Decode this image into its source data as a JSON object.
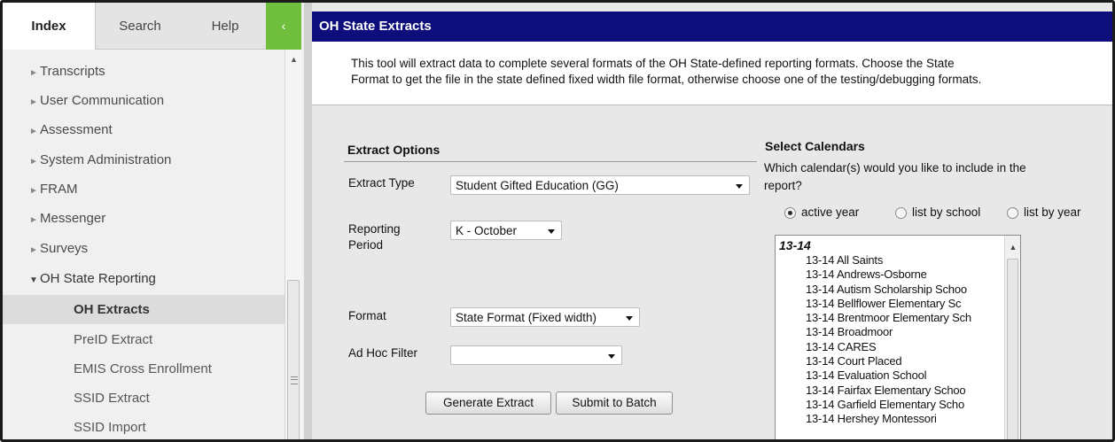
{
  "sidebar": {
    "tabs": [
      {
        "label": "Index"
      },
      {
        "label": "Search"
      },
      {
        "label": "Help"
      }
    ],
    "collapse_glyph": "‹",
    "menu": [
      {
        "label": "Transcripts",
        "arrow": "►"
      },
      {
        "label": "User Communication",
        "arrow": "►"
      },
      {
        "label": "Assessment",
        "arrow": "►"
      },
      {
        "label": "System Administration",
        "arrow": "►"
      },
      {
        "label": "FRAM",
        "arrow": "►"
      },
      {
        "label": "Messenger",
        "arrow": "►"
      },
      {
        "label": "Surveys",
        "arrow": "►"
      },
      {
        "label": "OH State Reporting",
        "arrow": "▼"
      }
    ],
    "submenu": [
      {
        "label": "OH Extracts"
      },
      {
        "label": "PreID Extract"
      },
      {
        "label": "EMIS Cross Enrollment"
      },
      {
        "label": "SSID Extract"
      },
      {
        "label": "SSID Import"
      }
    ]
  },
  "main": {
    "title": "OH State Extracts",
    "description_line1": "This tool will extract data to complete several formats of the OH State-defined reporting formats. Choose the State",
    "description_line2": "Format to get the file in the state defined fixed width file format, otherwise choose one of the testing/debugging formats.",
    "extract_options": {
      "heading": "Extract Options",
      "extract_type_label": "Extract Type",
      "extract_type_value": "Student Gifted Education (GG)",
      "reporting_period_label_1": "Reporting",
      "reporting_period_label_2": "Period",
      "reporting_period_value": "K - October",
      "format_label": "Format",
      "format_value": "State Format (Fixed width)",
      "ad_hoc_label": "Ad Hoc Filter",
      "ad_hoc_value": "",
      "generate_button": "Generate Extract",
      "batch_button": "Submit to Batch"
    },
    "calendars": {
      "heading": "Select Calendars",
      "question_1": "Which calendar(s) would you like to include in the",
      "question_2": "report?",
      "radio_active": "active year",
      "radio_school": "list by school",
      "radio_year": "list by year",
      "group": "13-14",
      "items": [
        "13-14 All Saints",
        "13-14 Andrews-Osborne",
        "13-14 Autism Scholarship Schoo",
        "13-14 Bellflower Elementary Sc",
        "13-14 Brentmoor Elementary Sch",
        "13-14 Broadmoor",
        "13-14 CARES",
        "13-14 Court Placed",
        "13-14 Evaluation School",
        "13-14 Fairfax Elementary Schoo",
        "13-14 Garfield Elementary Scho",
        "13-14 Hershey Montessori"
      ]
    }
  }
}
